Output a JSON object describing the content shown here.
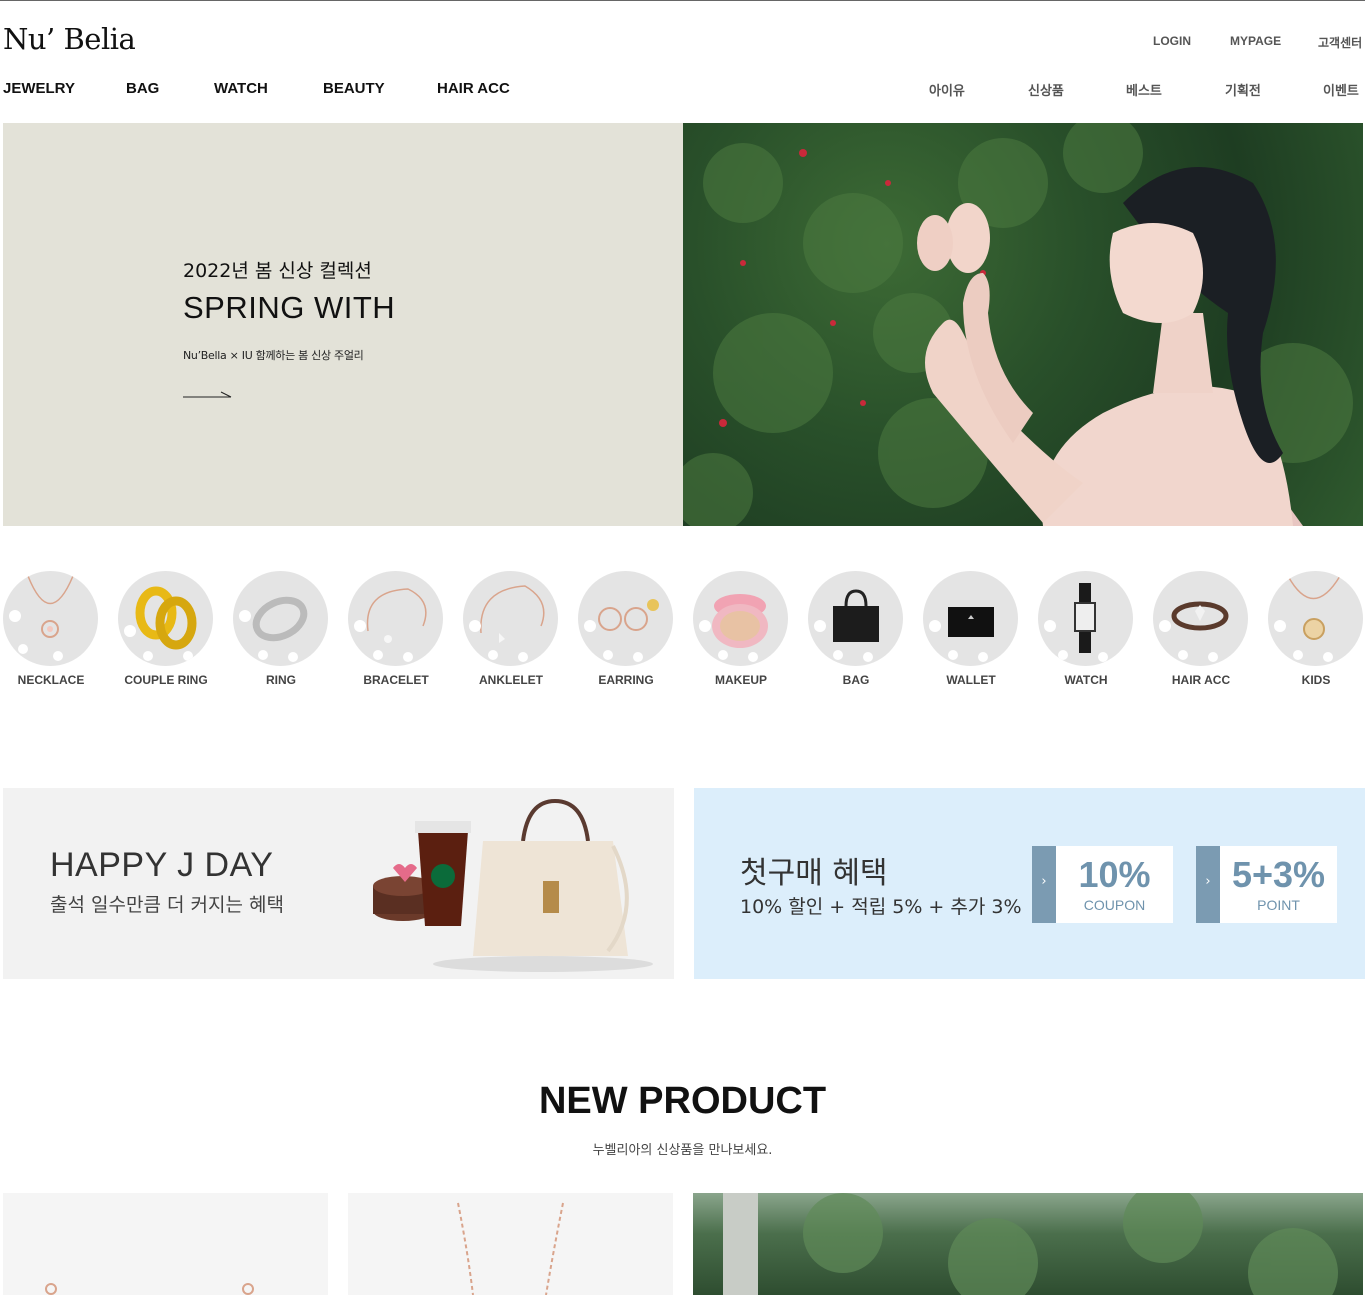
{
  "header": {
    "logo": "Nu’ Belia",
    "util_links": [
      "LOGIN",
      "MYPAGE",
      "고객센터"
    ],
    "gnb_left": [
      "JEWELRY",
      "BAG",
      "WATCH",
      "BEAUTY",
      "HAIR ACC"
    ],
    "gnb_right": [
      "아이유",
      "신상품",
      "베스트",
      "기획전",
      "이벤트"
    ]
  },
  "hero": {
    "subtitle": "2022년 봄 신상 컬렉션",
    "title": "SPRING WITH",
    "description": "Nu’Bella × IU 함께하는 봄 신상 주얼리",
    "background_color": "#e3e2d8"
  },
  "categories": [
    {
      "label": "NECKLACE",
      "icon": "necklace-icon"
    },
    {
      "label": "COUPLE RING",
      "icon": "couple-ring-icon"
    },
    {
      "label": "RING",
      "icon": "ring-icon"
    },
    {
      "label": "BRACELET",
      "icon": "bracelet-icon"
    },
    {
      "label": "ANKLELET",
      "icon": "anklet-icon"
    },
    {
      "label": "EARRING",
      "icon": "earring-icon"
    },
    {
      "label": "MAKEUP",
      "icon": "cushion-compact-icon"
    },
    {
      "label": "BAG",
      "icon": "handbag-icon"
    },
    {
      "label": "WALLET",
      "icon": "wallet-icon"
    },
    {
      "label": "WATCH",
      "icon": "watch-icon"
    },
    {
      "label": "HAIR ACC",
      "icon": "hair-tie-icon"
    },
    {
      "label": "KIDS",
      "icon": "kids-pendant-icon"
    }
  ],
  "banners": {
    "happy_j_day": {
      "title": "HAPPY J DAY",
      "subtitle": "출석 일수만큼 더 커지는 혜택"
    },
    "first_purchase": {
      "title": "첫구매 혜택",
      "subtitle": "10% 할인 + 적립 5% + 추가 3%",
      "coupons": [
        {
          "big": "10%",
          "small": "COUPON"
        },
        {
          "big": "5+3%",
          "small": "POINT"
        }
      ]
    }
  },
  "new_product": {
    "title": "NEW PRODUCT",
    "subtitle": "누벨리아의 신상품을 만나보세요."
  },
  "colors": {
    "accent_blue": "#6f93ad",
    "banner_blue": "#dceefb",
    "banner_gray": "#f2f2f2"
  }
}
